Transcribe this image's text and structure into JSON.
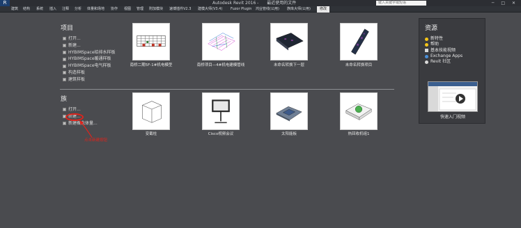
{
  "titlebar": {
    "app_title": "Autodesk Revit 2016 -",
    "doc_title": "最近使用的文件",
    "search_placeholder": "键入关键字或短语"
  },
  "ribbon": {
    "tabs": [
      "建筑",
      "结构",
      "系统",
      "插入",
      "注释",
      "分析",
      "体量和场地",
      "协作",
      "视图",
      "管理",
      "附加模块",
      "速博插件V2.3",
      "建模大师(V3.4)",
      "Fuzor Plugin",
      "鸿业管线(公用)",
      "族库大师(公用)",
      "修改"
    ],
    "active_tab": "修改"
  },
  "projects": {
    "heading": "项目",
    "links": [
      "打开...",
      "新建...",
      "HYBIMSpace给排水样板",
      "HYBIMSpace暖通样板",
      "HYBIMSpace电气样板",
      "构造样板",
      "建筑样板"
    ],
    "thumbnails": [
      {
        "caption": "南桥二期5F-1#机电模型"
      },
      {
        "caption": "南桥项目—4#机电建模管线"
      },
      {
        "caption": "未命名转换下一层"
      },
      {
        "caption": "未命名转换项目"
      }
    ]
  },
  "families": {
    "heading": "族",
    "links": [
      "打开...",
      "新建...",
      "新建概念体量..."
    ],
    "thumbnails": [
      {
        "caption": "变截柱"
      },
      {
        "caption": "Cisco视频会议"
      },
      {
        "caption": "太阳能板"
      },
      {
        "caption": "热回收机组1"
      }
    ]
  },
  "resources": {
    "heading": "资源",
    "links": [
      {
        "label": "新特性",
        "icon": "lightbulb-icon",
        "color": "#f5c518"
      },
      {
        "label": "帮助",
        "icon": "help-icon",
        "color": "#f5c518"
      },
      {
        "label": "基本技能视频",
        "icon": "video-icon",
        "color": "#d9d9d9"
      },
      {
        "label": "Exchange Apps",
        "icon": "exchange-icon",
        "color": "#4a8fd8"
      },
      {
        "label": "Revit 社区",
        "icon": "community-icon",
        "color": "#d9d9d9"
      }
    ],
    "video_caption": "快速入门视频"
  },
  "annotation": {
    "text": "点击新建按钮",
    "color": "#e0231b"
  }
}
